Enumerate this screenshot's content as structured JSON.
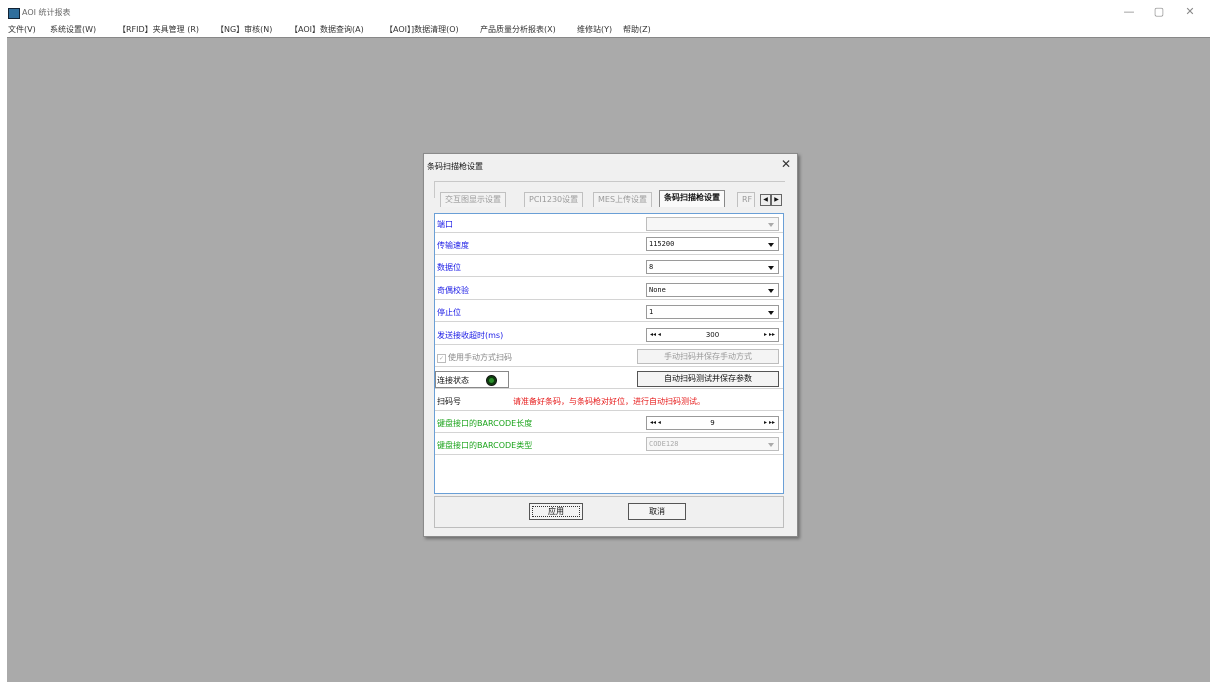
{
  "window": {
    "title": "AOI 统计报表",
    "controls": [
      "—",
      "▢",
      "✕"
    ]
  },
  "menubar": {
    "items": [
      "文件(V)",
      "系统设置(W)",
      "【RFID】夹具管理 (R)",
      "【NG】审核(N)",
      "【AOI】数据查询(A)",
      "【AOI】]数据清理(O)",
      "产品质量分析报表(X)",
      "维修站(Y)",
      "帮助(Z)"
    ]
  },
  "dialog": {
    "title": "条码扫描枪设置",
    "close_label": "✕",
    "tabs": [
      "交互图显示设置",
      "PCI1230设置",
      "MES上传设置",
      "条码扫描枪设置",
      "RF"
    ],
    "active_tab": "条码扫描枪设置",
    "tab_prev": "◀",
    "tab_next": "▶",
    "fields": {
      "port": {
        "label": "端口",
        "value": ""
      },
      "baud": {
        "label": "传输速度",
        "value": "115200"
      },
      "databits": {
        "label": "数据位",
        "value": "8"
      },
      "parity": {
        "label": "奇偶校验",
        "value": "None"
      },
      "stopbits": {
        "label": "停止位",
        "value": "1"
      },
      "timeout": {
        "label": "发送接收超时(ms)",
        "value": "300",
        "dec": "◂◂ ◂",
        "inc": "▸ ▸▸"
      },
      "manual_scan": {
        "label": "使用手动方式扫码",
        "checked": true,
        "check_mark": "✓",
        "button": "手动扫码并保存手动方式"
      },
      "conn_status": {
        "label": "连接状态",
        "button": "自动扫码测试并保存参数"
      },
      "scan_code": {
        "label": "扫码号",
        "message": "请准备好条码，与条码枪对好位，进行自动扫码测试。"
      },
      "kb_length": {
        "label": "键盘接口的BARCODE长度",
        "value": "9",
        "dec": "◂◂ ◂",
        "inc": "▸ ▸▸"
      },
      "kb_type": {
        "label": "键盘接口的BARCODE类型",
        "value": "CODE128"
      }
    },
    "buttons": {
      "apply": "应用",
      "cancel": "取消"
    }
  },
  "colors": {
    "workspace": "#aaaaaa",
    "label_blue": "#1a1ae6",
    "label_green": "#19a319",
    "message_red": "#e61a1a",
    "panel_border": "#6a9fd6",
    "status_led": "#2b8f2b"
  }
}
